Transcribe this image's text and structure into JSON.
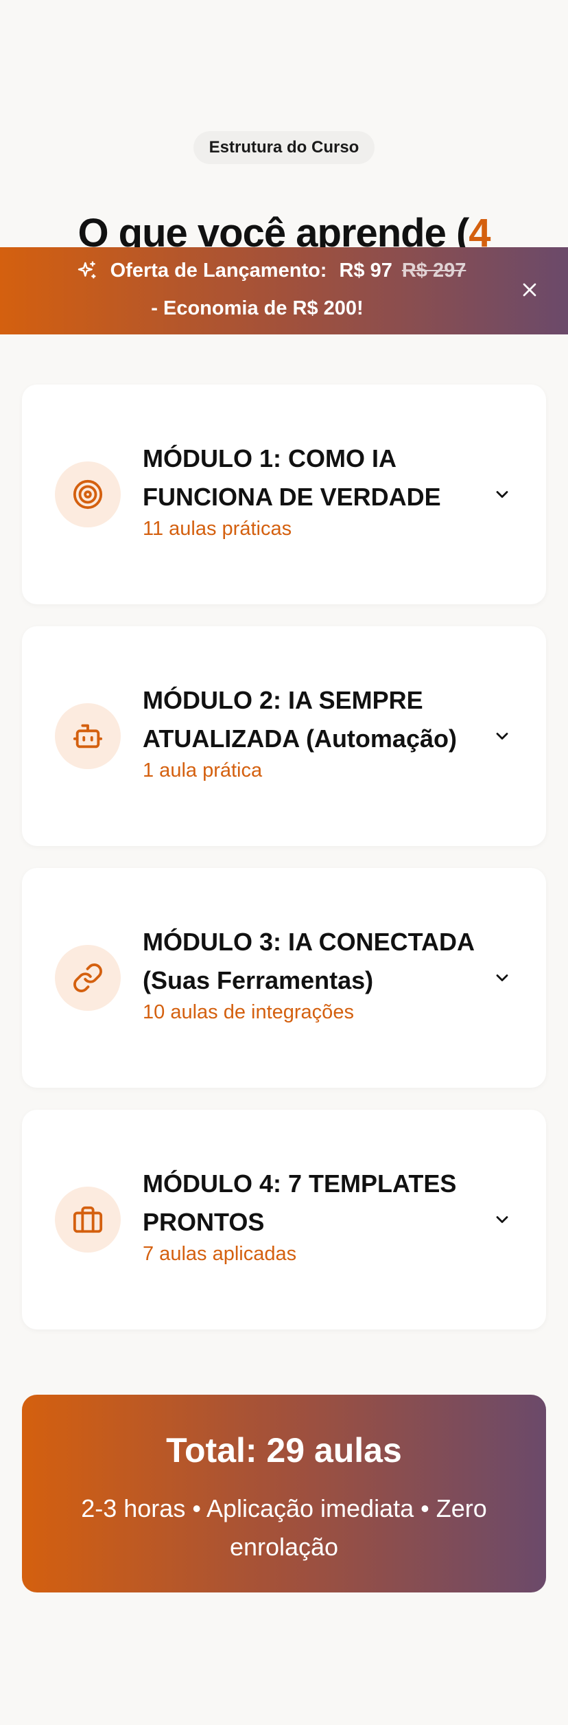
{
  "section": {
    "badge": "Estrutura do Curso",
    "title_prefix": "O que você aprende (",
    "title_accent": "4"
  },
  "promo": {
    "label": "Oferta de Lançamento:",
    "price": "R$ 97",
    "old_price": "R$ 297",
    "savings": "- Economia de R$ 200!",
    "icons": {
      "sparkle": "sparkle-icon",
      "close": "close-icon"
    }
  },
  "modules": [
    {
      "title": "MÓDULO 1: COMO IA FUNCIONA DE VERDADE",
      "subtitle": "11 aulas práticas",
      "icon": "target-icon"
    },
    {
      "title": "MÓDULO 2: IA SEMPRE ATUALIZADA (Automação)",
      "subtitle": "1 aula prática",
      "icon": "robot-icon"
    },
    {
      "title": "MÓDULO 3: IA CONECTADA (Suas Ferramentas)",
      "subtitle": "10 aulas de integrações",
      "icon": "link-icon"
    },
    {
      "title": "MÓDULO 4: 7 TEMPLATES PRONTOS",
      "subtitle": "7 aulas aplicadas",
      "icon": "briefcase-icon"
    }
  ],
  "total": {
    "title": "Total: 29 aulas",
    "description": "2-3 horas • Aplicação imediata • Zero enrolação"
  },
  "colors": {
    "accent": "#d4600f",
    "gradient_start": "#d4600f",
    "gradient_end": "#6b4a6a",
    "icon_bg": "#fcebdf",
    "page_bg": "#f9f8f6"
  }
}
